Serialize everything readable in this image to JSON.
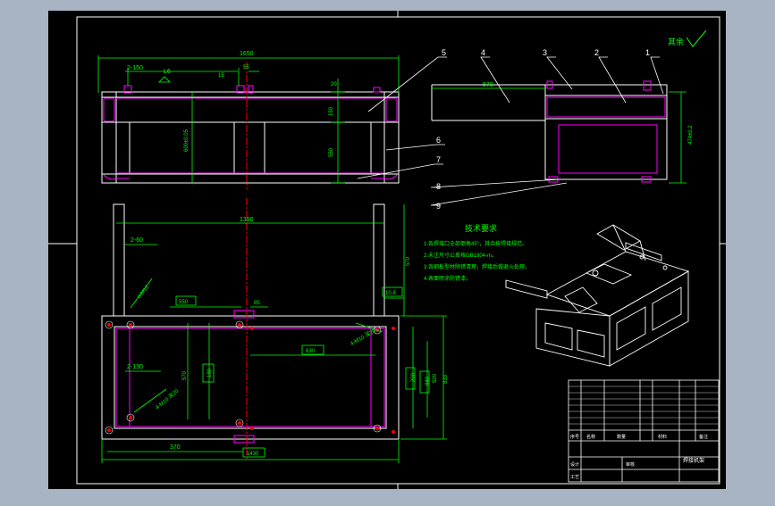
{
  "colors": {
    "background": "#a8b3c3",
    "sheet": "#000000",
    "border": "#ffffff",
    "dimension": "#00ff00",
    "outline": "#ffffff",
    "hidden": "#ff00ff",
    "center_line": "#ff0000",
    "leader": "#ffffff"
  },
  "roughness": {
    "label": "其余"
  },
  "front_view": {
    "dim_total": "1650",
    "dim_spacing": "2-150",
    "dim_left_small": "L6",
    "dim_15": "15",
    "dim_center": "55",
    "dim_20": "20",
    "dim_150": "150",
    "dim_550": "550",
    "dim_height": "600±0.05"
  },
  "side_view": {
    "dim_width": "570",
    "dim_height": "474±0.2"
  },
  "top_view": {
    "dim_1390": "1390",
    "dim_2_60": "2-60",
    "dim_570": "570",
    "dim_100_8": "10.8",
    "dim_550": "550",
    "dim_85": "85",
    "dim_630": "630",
    "dim_180": "180",
    "dim_2_130": "2-130",
    "dim_570b": "570",
    "dim_370": "370",
    "dim_1430": "1430",
    "dim_200": "200",
    "dim_840": "840",
    "dim_833": "833",
    "dim_520": "520",
    "hole_callout_1": "6-M12",
    "hole_callout_2": "4-M10 深20",
    "hole_callout_3": "4-M10 深20"
  },
  "balloons": [
    "1",
    "2",
    "3",
    "4",
    "5",
    "6",
    "7",
    "8",
    "9"
  ],
  "tech_req": {
    "title": "技术要求",
    "items": [
      "1.各焊接口全部倒角45°，其余按焊接规范。",
      "2.未注尺寸公差按GB1804-m。",
      "3.各钢板型材除锈清理，焊接后做退火处理。",
      "4.表面喷涂防锈漆。"
    ]
  },
  "title_block": {
    "header": [
      "序号",
      "名称",
      "数量",
      "材料",
      "备注"
    ],
    "sign_row": [
      "设计",
      "审核",
      "工艺"
    ],
    "drawing_name": "焊接机架"
  }
}
